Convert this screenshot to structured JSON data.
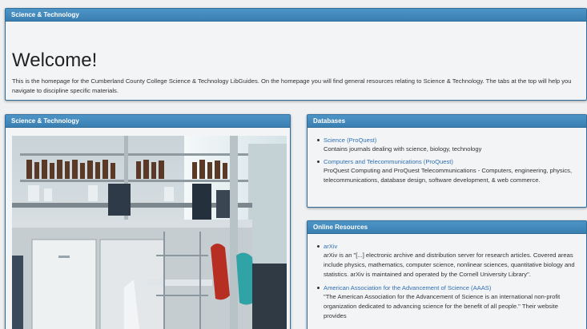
{
  "welcome_box": {
    "header": "Science & Technology",
    "title": "Welcome!",
    "text": "This is the homepage for the Cumberland County College Science & Technology LibGuides.  On the homepage you will find general resources relating to Science & Technology.  The tabs at the top will help you navigate to discipline specific materials."
  },
  "image_box": {
    "header": "Science & Technology"
  },
  "databases_box": {
    "header": "Databases",
    "items": [
      {
        "link": "Science (ProQuest)",
        "description": "Contains journals dealing with science, biology, technology"
      },
      {
        "link": "Computers and Telecommunications (ProQuest)",
        "description": "ProQuest Computing and ProQuest Telecommunications - Computers, engineering, physics, telecommunications, database design, software development, & web commerce."
      }
    ]
  },
  "online_box": {
    "header": "Online Resources",
    "items": [
      {
        "link": "arXiv",
        "description": "arXiv is an \"[...] electronic archive and distribution server for research articles. Covered areas include physics, mathematics, computer science, nonlinear sciences, quantitative biology and statistics. arXiv is maintained and operated by the Cornell University Library\"."
      },
      {
        "link": "American Association for the Advancement of Science (AAAS)",
        "description": "\"The American Association for the Advancement of Science is an international non-profit organization dedicated to advancing science for the benefit of all people.\" Their website provides"
      }
    ]
  },
  "colors": {
    "header_blue": "#3f86b8",
    "link_blue": "#2f6fb2",
    "panel_border": "#2f6e9c"
  }
}
